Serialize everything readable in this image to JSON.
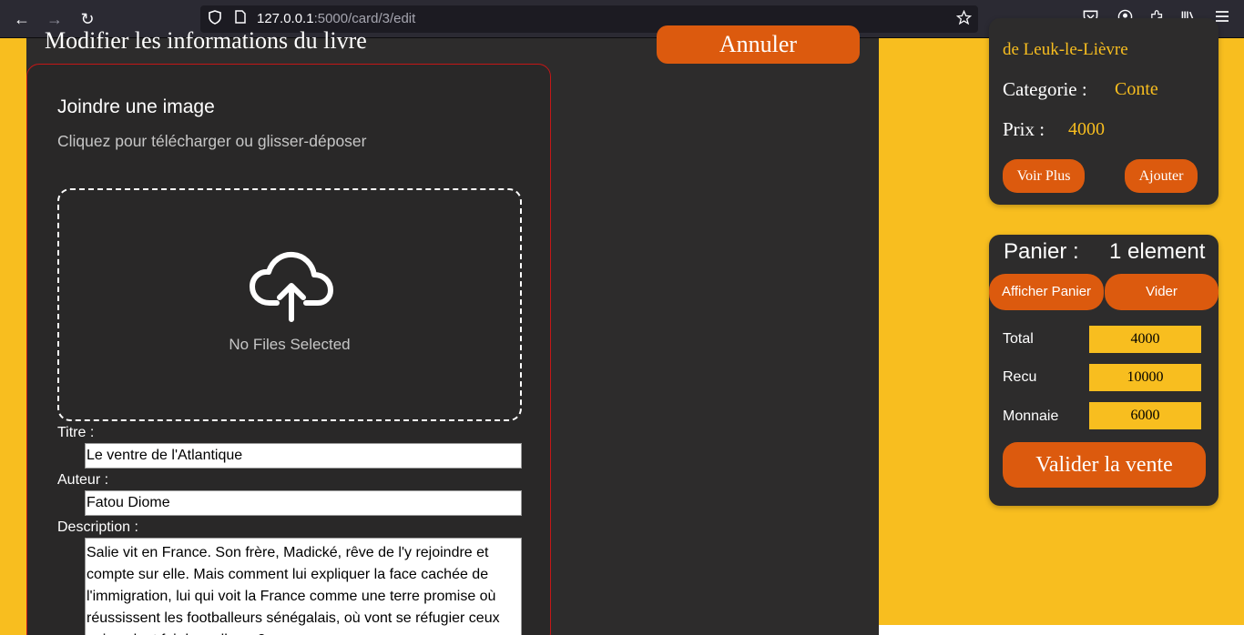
{
  "browser": {
    "url_host": "127.0.0.1",
    "url_path": ":5000/card/3/edit",
    "back": "←",
    "forward": "→",
    "reload": "↻"
  },
  "header": {
    "page_title": "Modifier les informations du livre",
    "cancel_label": "Annuler"
  },
  "form": {
    "image_title": "Joindre une image",
    "image_subtitle": "Cliquez pour télécharger ou glisser-déposer",
    "no_files": "No Files Selected",
    "titre_label": "Titre :",
    "titre_value": "Le ventre de l'Atlantique",
    "auteur_label": "Auteur :",
    "auteur_value": "Fatou Diome",
    "description_label": "Description :",
    "description_value": "Salie vit en France. Son frère, Madické, rêve de l'y rejoindre et compte sur elle. Mais comment lui expliquer la face cachée de l'immigration, lui qui voit la France comme une terre promise où réussissent les footballeurs sénégalais, où vont se réfugier ceux qui veulent fuir le malheur ?"
  },
  "book_card": {
    "author": "de Leuk-le-Lièvre",
    "categorie_label": "Categorie :",
    "categorie_value": "Conte",
    "prix_label": "Prix :",
    "prix_value": "4000",
    "voir_plus": "Voir Plus",
    "ajouter": "Ajouter"
  },
  "cart": {
    "label": "Panier :",
    "count": "1 element",
    "show_label": "Afficher Panier",
    "clear_label": "Vider",
    "total_label": "Total",
    "total_value": "4000",
    "recu_label": "Recu",
    "recu_value": "10000",
    "monnaie_label": "Monnaie",
    "monnaie_value": "6000",
    "validate_label": "Valider la vente"
  },
  "colors": {
    "accent": "#dc5a0e",
    "background": "#f8be1f",
    "panel": "#2d2c2c",
    "card_border": "#c41717"
  }
}
